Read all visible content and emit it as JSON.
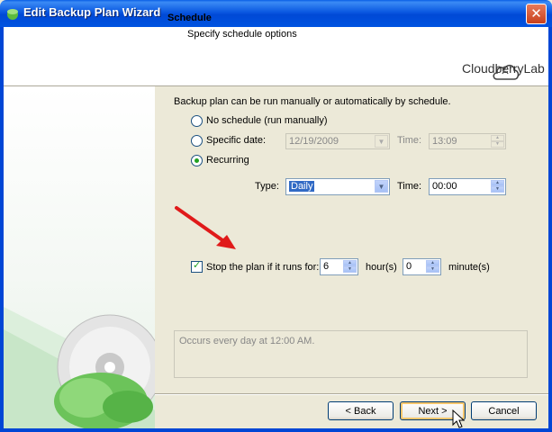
{
  "window": {
    "title": "Edit Backup Plan Wizard",
    "close_symbol": "✕"
  },
  "header": {
    "title": "Schedule",
    "subtitle": "Specify schedule options",
    "brand": "CloudberryLab"
  },
  "content": {
    "intro": "Backup plan can be run manually or automatically by schedule.",
    "options": {
      "no_schedule": "No schedule (run manually)",
      "specific_date": "Specific date:",
      "recurring": "Recurring"
    },
    "selected_option": "recurring",
    "specific": {
      "date_value": "12/19/2009",
      "time_label": "Time:",
      "time_value": "13:09"
    },
    "recurring": {
      "type_label": "Type:",
      "type_value": "Daily",
      "time_label": "Time:",
      "time_value": "00:00"
    },
    "stop": {
      "checked": true,
      "label": "Stop the plan if it runs for:",
      "hours_value": "6",
      "hours_unit": "hour(s)",
      "minutes_value": "0",
      "minutes_unit": "minute(s)"
    },
    "summary": "Occurs every day at 12:00 AM."
  },
  "buttons": {
    "back": "< Back",
    "next": "Next >",
    "cancel": "Cancel"
  },
  "colors": {
    "titlebar": "#0054e3",
    "accent_green": "#21a121",
    "annotation_arrow": "#e01a1a"
  }
}
